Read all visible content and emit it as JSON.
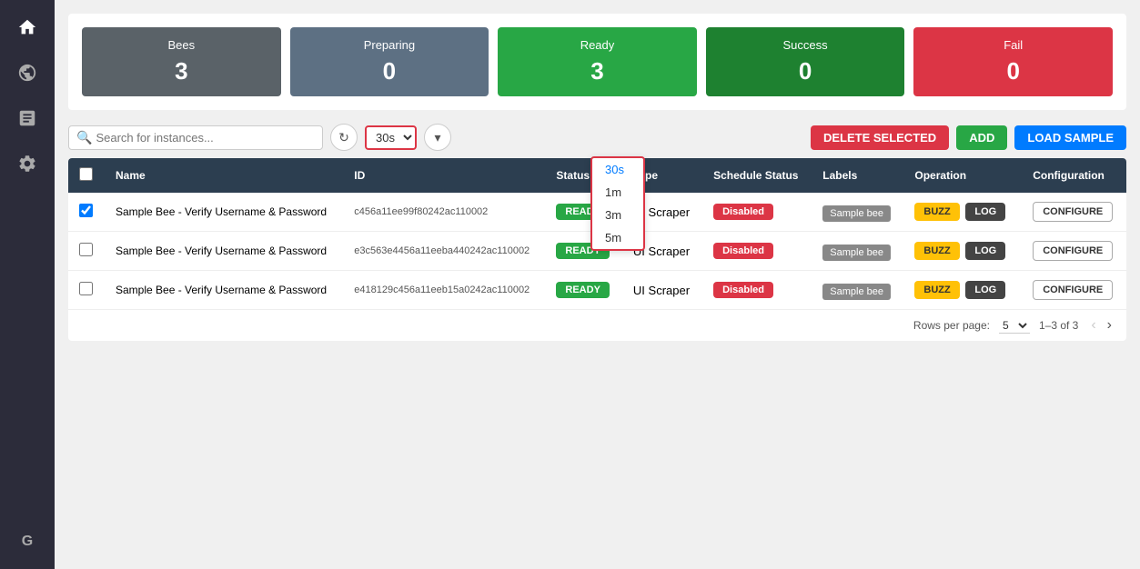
{
  "sidebar": {
    "icons": [
      {
        "name": "home-icon",
        "glyph": "🏠"
      },
      {
        "name": "network-icon",
        "glyph": "🌐"
      },
      {
        "name": "report-icon",
        "glyph": "📋"
      },
      {
        "name": "settings-icon",
        "glyph": "⚙️"
      }
    ],
    "bottom_icon": {
      "name": "google-icon",
      "glyph": "G"
    }
  },
  "stats": [
    {
      "label": "Bees",
      "value": "3",
      "color": "gray"
    },
    {
      "label": "Preparing",
      "value": "0",
      "color": "blue-gray"
    },
    {
      "label": "Ready",
      "value": "3",
      "color": "green"
    },
    {
      "label": "Success",
      "value": "0",
      "color": "dark-green"
    },
    {
      "label": "Fail",
      "value": "0",
      "color": "red"
    }
  ],
  "toolbar": {
    "search_placeholder": "Search for instances...",
    "interval_value": "30s",
    "delete_label": "DELETE SELECTED",
    "add_label": "ADD",
    "load_sample_label": "LOAD SAMPLE"
  },
  "interval_options": [
    "30s",
    "1m",
    "3m",
    "5m"
  ],
  "table": {
    "columns": [
      "",
      "Name",
      "ID",
      "Status",
      "Type",
      "Schedule Status",
      "Labels",
      "Operation",
      "Configuration"
    ],
    "rows": [
      {
        "checked": true,
        "name": "Sample Bee - Verify Username & Password",
        "id": "c456a11ee99f80242ac110002",
        "status": "READY",
        "type": "UI Scraper",
        "schedule_status": "Disabled",
        "labels": "Sample bee",
        "buzz": "BUZZ",
        "log": "LOG",
        "configure": "CONFIGURE"
      },
      {
        "checked": false,
        "name": "Sample Bee - Verify Username & Password",
        "id": "e3c563e4456a11eeba440242ac110002",
        "status": "READY",
        "type": "UI Scraper",
        "schedule_status": "Disabled",
        "labels": "Sample bee",
        "buzz": "BUZZ",
        "log": "LOG",
        "configure": "CONFIGURE"
      },
      {
        "checked": false,
        "name": "Sample Bee - Verify Username & Password",
        "id": "e418129c456a11eeb15a0242ac110002",
        "status": "READY",
        "type": "UI Scraper",
        "schedule_status": "Disabled",
        "labels": "Sample bee",
        "buzz": "BUZZ",
        "log": "LOG",
        "configure": "CONFIGURE"
      }
    ],
    "rows_per_page_label": "Rows per page:",
    "rows_per_page_value": "5",
    "page_info": "1–3 of 3"
  }
}
